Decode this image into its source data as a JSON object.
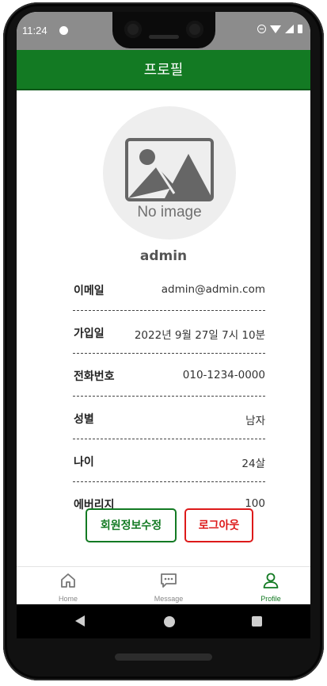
{
  "status_bar": {
    "time": "11:24"
  },
  "app_bar": {
    "title": "프로필"
  },
  "profile": {
    "avatar_placeholder": "No image",
    "username": "admin"
  },
  "info": [
    {
      "label": "이메일",
      "value": "admin@admin.com"
    },
    {
      "label": "가입일",
      "value": "2022년 9월 27일 7시 10분"
    },
    {
      "label": "전화번호",
      "value": "010-1234-0000"
    },
    {
      "label": "성별",
      "value": "남자"
    },
    {
      "label": "나이",
      "value": "24살"
    },
    {
      "label": "에버리지",
      "value": "100"
    }
  ],
  "buttons": {
    "edit_label": "회원정보수정",
    "logout_label": "로그아웃"
  },
  "bottom_nav": [
    {
      "label": "Home",
      "icon": "home-icon"
    },
    {
      "label": "Message",
      "icon": "message-icon"
    },
    {
      "label": "Profile",
      "icon": "person-icon",
      "active": true
    }
  ],
  "colors": {
    "primary": "#137a23",
    "danger": "#dd1a1a",
    "divider": "#444444"
  }
}
